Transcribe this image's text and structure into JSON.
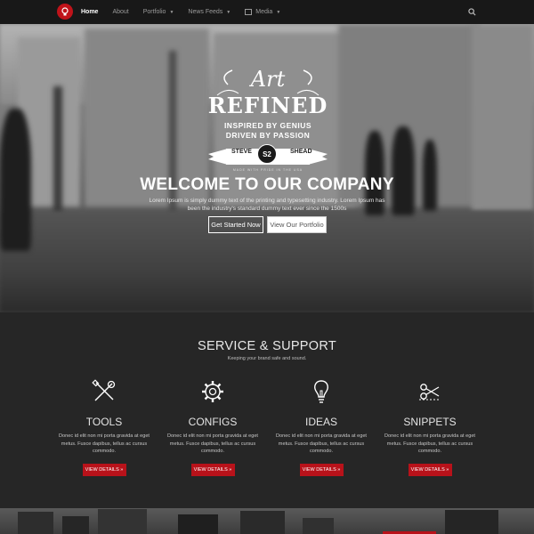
{
  "nav": {
    "items": [
      {
        "label": "Home",
        "active": true
      },
      {
        "label": "Portfolio",
        "caret": true
      },
      {
        "label": "News Feeds",
        "caret": true
      },
      {
        "label": "Media",
        "caret": true,
        "icon": "image-icon"
      }
    ],
    "search_icon": "search-icon",
    "logo_icon": "bulb-logo-icon"
  },
  "hero": {
    "badge": {
      "art": "Art",
      "refined": "REFINED",
      "tagline1": "INSPIRED BY GENIUS",
      "tagline2": "DRIVEN BY PASSION",
      "left": "STEVE",
      "center": "S2",
      "right": "SHEAD",
      "made": "MADE WITH PRIDE IN THE USA"
    },
    "title": "WELCOME TO OUR COMPANY",
    "text": "Lorem Ipsum is simply dummy text of the printing and typesetting industry. Lorem Ipsum has been the industry's standard dummy text ever since the 1500s",
    "btn_primary": "Get Started Now",
    "btn_secondary": "View Our Portfolio"
  },
  "services": {
    "title": "SERVICE & SUPPORT",
    "subtitle": "Keeping your brand safe and sound.",
    "items": [
      {
        "icon": "tools-icon",
        "title": "TOOLS",
        "text": "Donec id elit non mi porta gravida at eget metus. Fusce dapibus, tellus ac cursus commodo.",
        "button": "VIEW DETAILS »"
      },
      {
        "icon": "gear-icon",
        "title": "CONFIGS",
        "text": "Donec id elit non mi porta gravida at eget metus. Fusce dapibus, tellus ac cursus commodo.",
        "button": "VIEW DETAILS »"
      },
      {
        "icon": "lightbulb-icon",
        "title": "IDEAS",
        "text": "Donec id elit non mi porta gravida at eget metus. Fusce dapibus, tellus ac cursus commodo.",
        "button": "VIEW DETAILS »"
      },
      {
        "icon": "scissors-icon",
        "title": "SNIPPETS",
        "text": "Donec id elit non mi porta gravida at eget metus. Fusce dapibus, tellus ac cursus commodo.",
        "button": "VIEW DETAILS »"
      }
    ]
  },
  "colors": {
    "accent": "#b8121a",
    "nav_bg": "#181818",
    "body_bg": "#262626"
  }
}
